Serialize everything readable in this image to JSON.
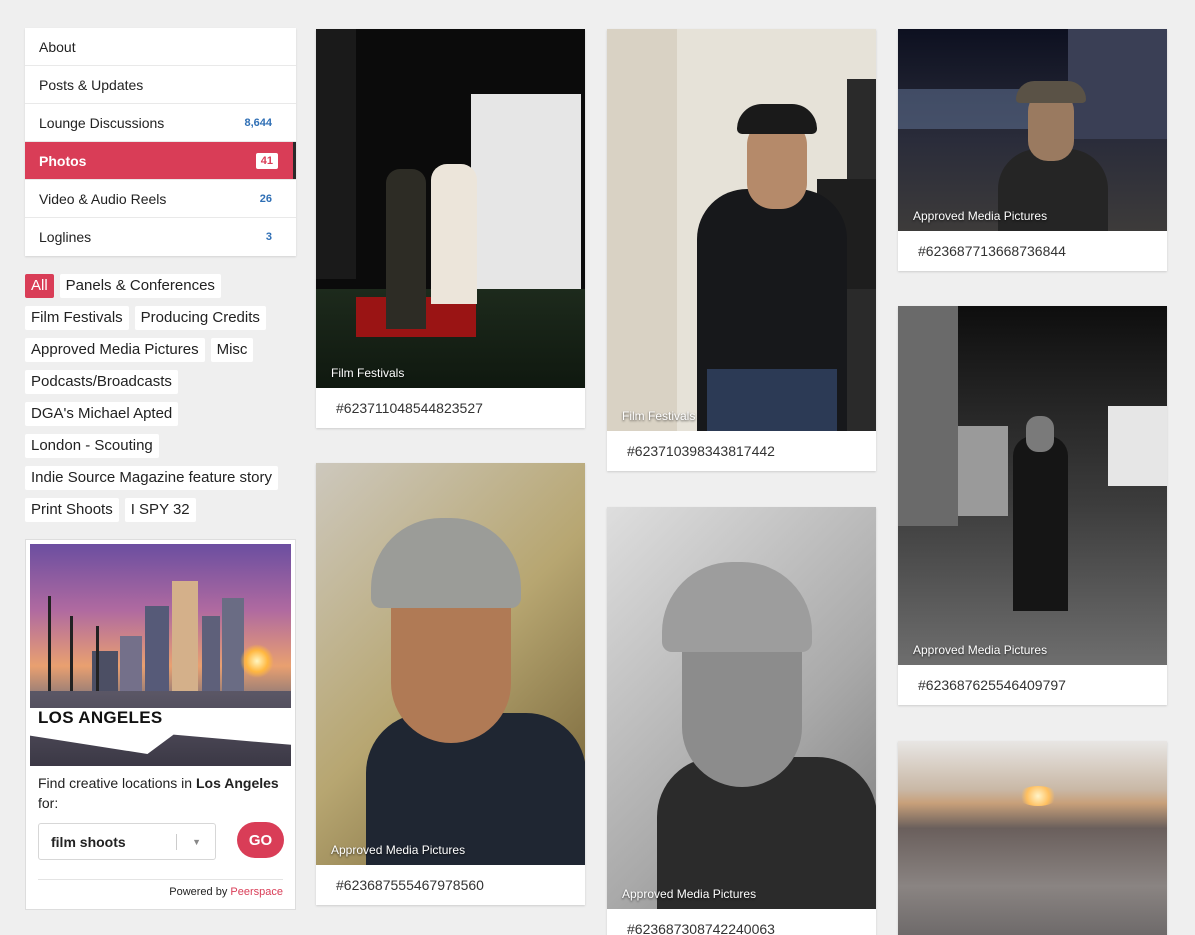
{
  "nav": [
    {
      "label": "About",
      "count": ""
    },
    {
      "label": "Posts & Updates",
      "count": ""
    },
    {
      "label": "Lounge Discussions",
      "count": "8,644"
    },
    {
      "label": "Photos",
      "count": "41",
      "active": true
    },
    {
      "label": "Video & Audio Reels",
      "count": "26"
    },
    {
      "label": "Loglines",
      "count": "3"
    }
  ],
  "tags": [
    "All",
    "Panels & Conferences",
    "Film Festivals",
    "Producing Credits",
    "Approved Media Pictures",
    "Misc",
    "Podcasts/Broadcasts",
    "DGA's Michael Apted",
    "London - Scouting",
    "Indie Source Magazine feature story",
    "Print Shoots",
    "I SPY 32"
  ],
  "promo": {
    "title": "LOS ANGELES",
    "text_prefix": "Find creative locations in ",
    "city": "Los Angeles",
    "text_suffix": " for:",
    "select_value": "film shoots",
    "go_label": "GO",
    "powered_prefix": "Powered by ",
    "powered_brand": "Peerspace"
  },
  "photos": [
    {
      "category": "Film Festivals",
      "code": "#623711048544823527"
    },
    {
      "category": "Approved Media Pictures",
      "code": "#623687555467978560"
    },
    {
      "category": "Film Festivals",
      "code": "#623710398343817442"
    },
    {
      "category": "Approved Media Pictures",
      "code": "#623687308742240063"
    },
    {
      "category": "Approved Media Pictures",
      "code": "#623687713668736844"
    },
    {
      "category": "Approved Media Pictures",
      "code": "#623687625546409797"
    },
    {
      "category": "",
      "code": ""
    }
  ],
  "colors": {
    "accent": "#d93d57",
    "count": "#2f6fb5"
  }
}
